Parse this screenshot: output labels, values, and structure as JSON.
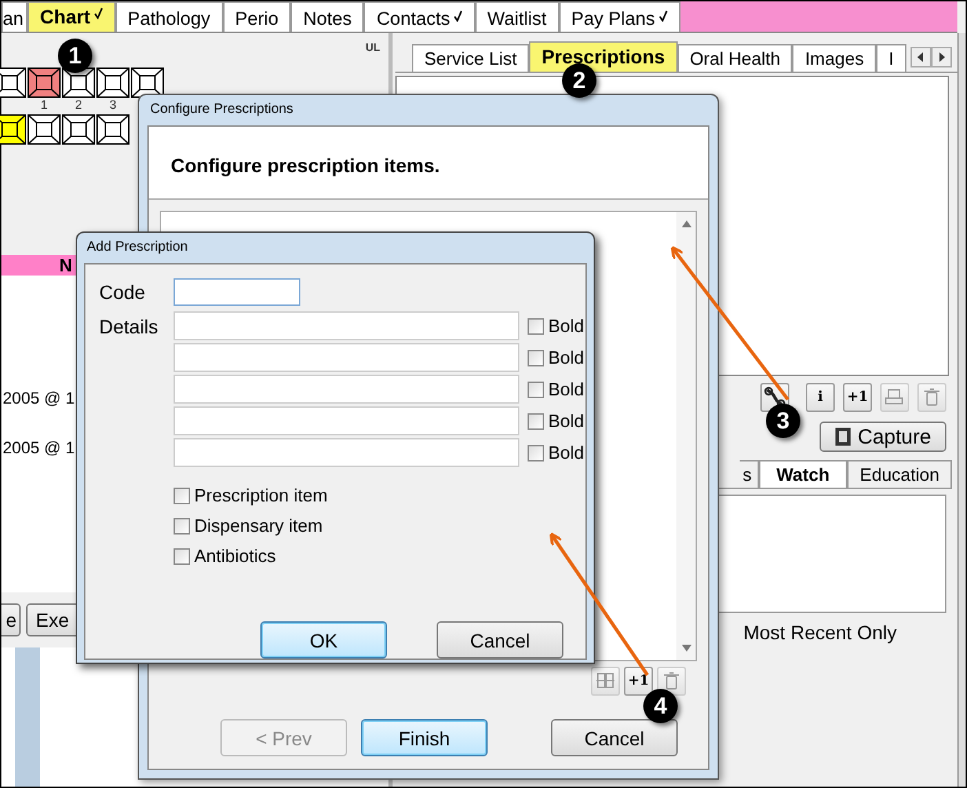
{
  "app": {
    "top_tabs": [
      {
        "label": "an",
        "selected": false,
        "checked": false
      },
      {
        "label": "Chart",
        "selected": true,
        "checked": true
      },
      {
        "label": "Pathology",
        "selected": false,
        "checked": false
      },
      {
        "label": "Perio",
        "selected": false,
        "checked": false
      },
      {
        "label": "Notes",
        "selected": false,
        "checked": false
      },
      {
        "label": "Contacts",
        "selected": false,
        "checked": true
      },
      {
        "label": "Waitlist",
        "selected": false,
        "checked": false
      },
      {
        "label": "Pay Plans",
        "selected": false,
        "checked": true
      }
    ],
    "chart": {
      "quadrant_label": "UL",
      "tooth_rows": [
        {
          "teeth": [
            {
              "color": "#ffffff"
            },
            {
              "color": "#f08080",
              "number": "1"
            },
            {
              "color": "#ffffff",
              "number": "2"
            },
            {
              "color": "#ffffff",
              "number": "3"
            },
            {
              "color": "#ffffff"
            }
          ]
        },
        {
          "teeth": [
            {
              "color": "#ffff00"
            },
            {
              "color": "#ffffff"
            },
            {
              "color": "#ffffff"
            },
            {
              "color": "#ffffff"
            }
          ]
        }
      ],
      "list_header": "N",
      "entries": [
        "2005 @ 1",
        "2005 @ 1"
      ],
      "buttons": [
        "e",
        "Exe"
      ]
    },
    "right_panel": {
      "tabs": [
        {
          "label": "Service List",
          "selected": false
        },
        {
          "label": "Prescriptions",
          "selected": true
        },
        {
          "label": "Oral Health",
          "selected": false
        },
        {
          "label": "Images",
          "selected": false
        },
        {
          "label": "I",
          "selected": false
        }
      ],
      "toolbar": [
        {
          "kind": "wrench",
          "disabled": false
        },
        {
          "kind": "info",
          "label": "i",
          "disabled": false
        },
        {
          "kind": "add",
          "label": "+1",
          "disabled": false
        },
        {
          "kind": "stamp",
          "disabled": true
        },
        {
          "kind": "trash",
          "disabled": true
        }
      ],
      "capture_button": "Capture",
      "lower_tabs": [
        {
          "label": "s",
          "selected": false
        },
        {
          "label": "Watch",
          "selected": true
        },
        {
          "label": "Education",
          "selected": false
        }
      ],
      "footer_label": "Most Recent Only"
    }
  },
  "configure_dialog": {
    "title": "Configure Prescriptions",
    "heading": "Configure prescription items.",
    "toolbar": [
      {
        "kind": "edit",
        "disabled": true
      },
      {
        "kind": "add",
        "label": "+1",
        "disabled": false
      },
      {
        "kind": "trash",
        "disabled": true
      }
    ],
    "buttons": [
      {
        "label": "< Prev",
        "disabled": true,
        "default": false
      },
      {
        "label": "Finish",
        "disabled": false,
        "default": true
      },
      {
        "label": "Cancel",
        "disabled": false,
        "default": false
      }
    ]
  },
  "add_dialog": {
    "title": "Add Prescription",
    "code_label": "Code",
    "details_label": "Details",
    "details_rows": [
      {
        "bold_label": "Bold",
        "bold_checked": false
      },
      {
        "bold_label": "Bold",
        "bold_checked": false
      },
      {
        "bold_label": "Bold",
        "bold_checked": false
      },
      {
        "bold_label": "Bold",
        "bold_checked": false
      },
      {
        "bold_label": "Bold",
        "bold_checked": false
      }
    ],
    "options": [
      {
        "label": "Prescription item",
        "checked": false
      },
      {
        "label": "Dispensary item",
        "checked": false
      },
      {
        "label": "Antibiotics",
        "checked": false
      }
    ],
    "buttons": [
      {
        "label": "OK",
        "default": true
      },
      {
        "label": "Cancel",
        "default": false
      }
    ]
  },
  "callouts": [
    "1",
    "2",
    "3",
    "4"
  ]
}
